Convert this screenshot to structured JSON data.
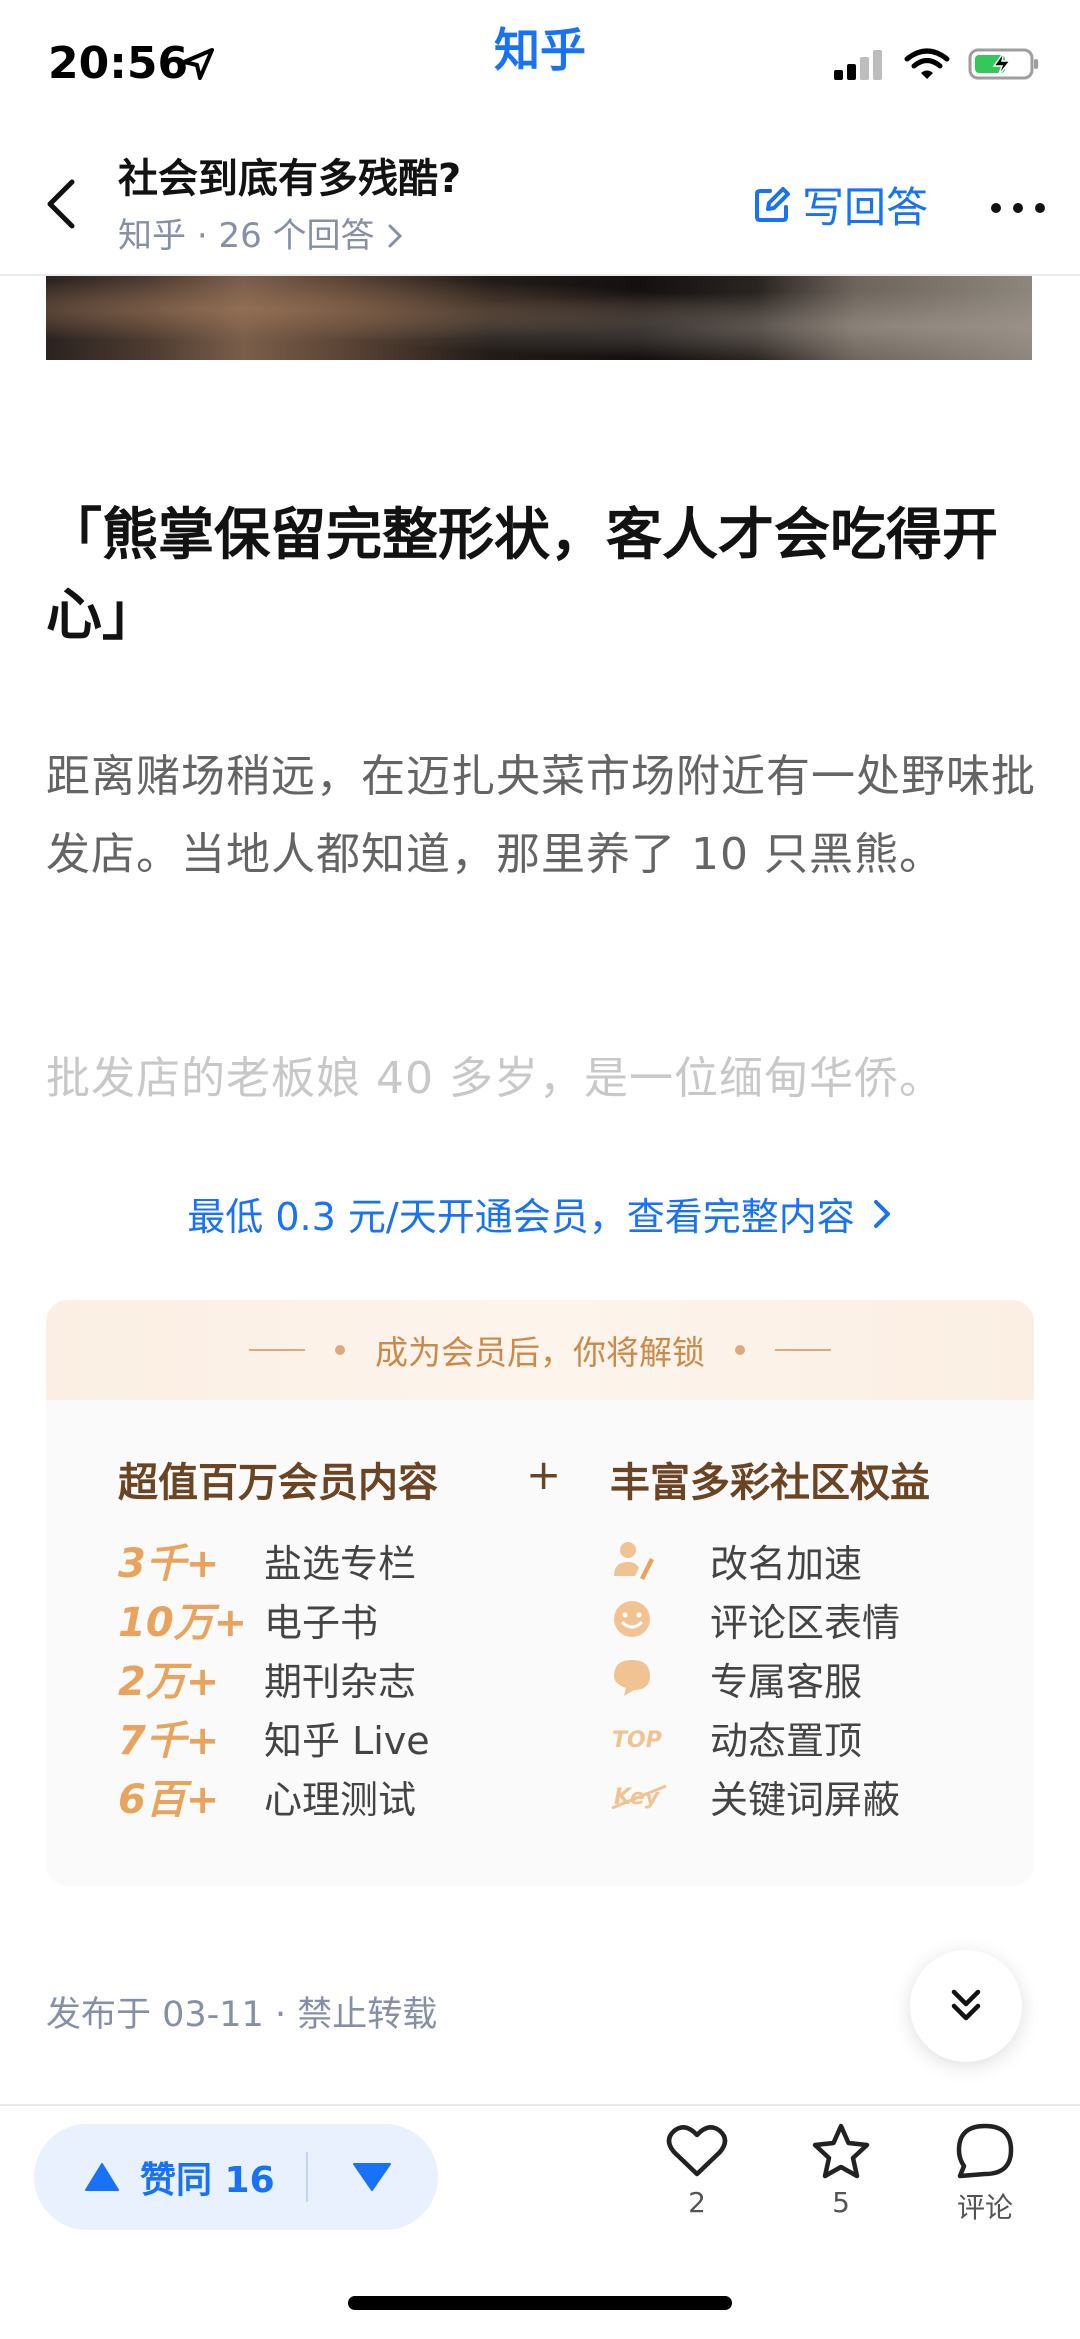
{
  "status_bar": {
    "time": "20:56",
    "app_name": "知乎"
  },
  "nav": {
    "title": "社会到底有多残酷?",
    "source": "知乎",
    "separator": "·",
    "answer_count": "26 个回答",
    "write_answer_label": "写回答"
  },
  "article": {
    "quote_title": "「熊掌保留完整形状，客人才会吃得开心」",
    "paragraph": "距离赌场稍远，在迈扎央菜市场附近有一处野味批发店。当地人都知道，那里养了 10 只黑熊。",
    "faded_paragraph": "批发店的老板娘 40 多岁，是一位缅甸华侨。"
  },
  "member_link": "最低 0.3 元/天开通会员，查看完整内容",
  "vip_card": {
    "header": "成为会员后，你将解锁",
    "left_title": "超值百万会员内容",
    "plus": "+",
    "right_title": "丰富多彩社区权益",
    "content_items": [
      {
        "count": "3千+",
        "label": "盐选专栏"
      },
      {
        "count": "10万+",
        "label": "电子书"
      },
      {
        "count": "2万+",
        "label": "期刊杂志"
      },
      {
        "count": "7千+",
        "label": "知乎 Live"
      },
      {
        "count": "6百+",
        "label": "心理测试"
      }
    ],
    "perks": [
      {
        "icon": "rename-icon",
        "label": "改名加速"
      },
      {
        "icon": "emoji-icon",
        "label": "评论区表情"
      },
      {
        "icon": "service-icon",
        "label": "专属客服"
      },
      {
        "icon": "top-icon",
        "label": "动态置顶"
      },
      {
        "icon": "keyword-icon",
        "label": "关键词屏蔽"
      }
    ],
    "perk_badges": {
      "top": "TOP",
      "key": "Key"
    }
  },
  "publish_info": "发布于 03-11 · 禁止转载",
  "bottom_bar": {
    "upvote_label": "赞同 16",
    "like_count": "2",
    "favorite_count": "5",
    "comment_label": "评论"
  },
  "colors": {
    "accent": "#1772f6",
    "vip_gold": "#e8a35d",
    "vip_brown": "#6b4423"
  }
}
